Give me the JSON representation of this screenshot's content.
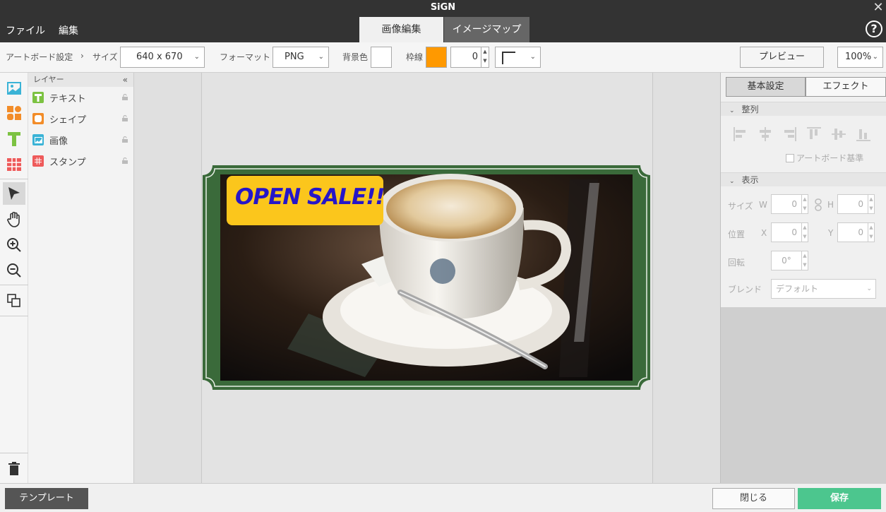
{
  "app": {
    "title": "SiGN",
    "close_glyph": "✕"
  },
  "menu": {
    "file": "ファイル",
    "edit": "編集",
    "help": "?"
  },
  "mode_tabs": {
    "image_edit": "画像編集",
    "image_map": "イメージマップ"
  },
  "toolbar": {
    "artboard_settings": "アートボード設定",
    "arrow": "›",
    "size_label": "サイズ",
    "size_value": "640 x 670",
    "format_label": "フォーマット",
    "format_value": "PNG",
    "bg_color_label": "背景色",
    "bg_color": "#ffffff",
    "border_label": "枠線",
    "border_color": "#ff9900",
    "border_width": "0",
    "preview": "プレビュー",
    "zoom": "100%"
  },
  "tools": [
    {
      "name": "image-tool-icon",
      "color": "#3ab3d6"
    },
    {
      "name": "shape-tool-icon",
      "color": "#f28c28"
    },
    {
      "name": "text-tool-icon",
      "color": "#7cc242"
    },
    {
      "name": "stamp-tool-icon",
      "color": "#ee5a5a"
    },
    {
      "name": "select-arrow-icon",
      "color": "#333333"
    },
    {
      "name": "hand-icon",
      "color": "#333333"
    },
    {
      "name": "zoom-in-icon",
      "color": "#333333"
    },
    {
      "name": "zoom-out-icon",
      "color": "#333333"
    },
    {
      "name": "arrange-icon",
      "color": "#333333"
    },
    {
      "name": "trash-icon",
      "color": "#333333"
    }
  ],
  "layers": {
    "header": "レイヤー",
    "collapse": "«",
    "items": [
      {
        "label": "テキスト",
        "icon": "text-layer-icon",
        "color": "#7cc242"
      },
      {
        "label": "シェイプ",
        "icon": "shape-layer-icon",
        "color": "#f28c28"
      },
      {
        "label": "画像",
        "icon": "image-layer-icon",
        "color": "#3ab3d6"
      },
      {
        "label": "スタンプ",
        "icon": "stamp-layer-icon",
        "color": "#ee5a5a"
      }
    ]
  },
  "canvas": {
    "banner_text": "OPEN SALE!!",
    "frame_color": "#3a6a3a",
    "banner_bg": "#fbc61c",
    "banner_text_color": "#2616c8"
  },
  "props": {
    "tab_basic": "基本設定",
    "tab_effect": "エフェクト",
    "align_header": "整列",
    "artboard_basis": "アートボード基準",
    "display_header": "表示",
    "size_label": "サイズ",
    "w_label": "W",
    "h_label": "H",
    "w_value": "0",
    "h_value": "0",
    "pos_label": "位置",
    "x_label": "X",
    "y_label": "Y",
    "x_value": "0",
    "y_value": "0",
    "rotate_label": "回転",
    "rotate_value": "0°",
    "blend_label": "ブレンド",
    "blend_value": "デフォルト"
  },
  "bottom": {
    "template": "テンプレート",
    "close": "閉じる",
    "save": "保存"
  }
}
